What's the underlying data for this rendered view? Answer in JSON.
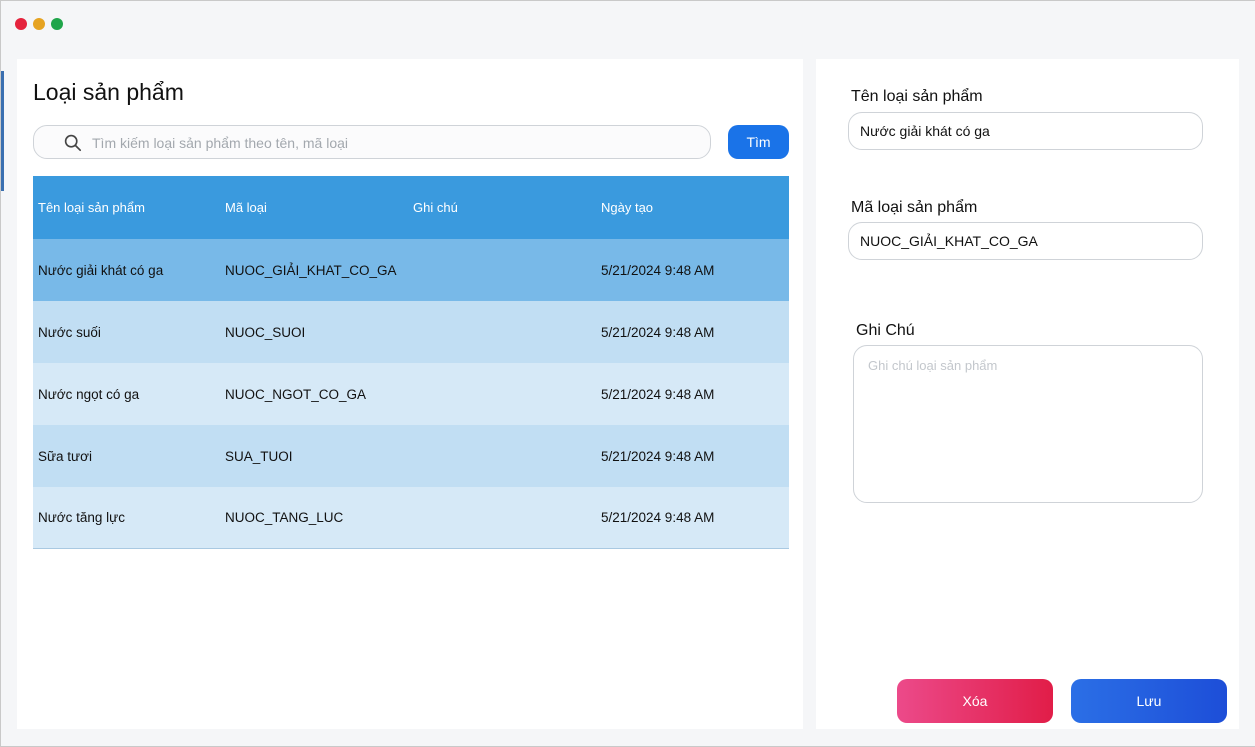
{
  "window": {
    "controls": [
      "close",
      "minimize",
      "maximize"
    ]
  },
  "list_panel": {
    "title": "Loại sản phẩm",
    "search": {
      "placeholder": "Tìm kiếm loại sản phẩm theo tên, mã loại",
      "value": "",
      "icon": "search-icon",
      "button_label": "Tìm"
    },
    "table": {
      "headers": [
        "Tên loại sản phẩm",
        "Mã loại",
        "Ghi chú",
        "Ngày tạo"
      ],
      "rows": [
        [
          "Nước giải khát có ga",
          "NUOC_GIẢI_KHAT_CO_GA",
          "",
          "5/21/2024 9:48 AM"
        ],
        [
          "Nước suối",
          "NUOC_SUOI",
          "",
          "5/21/2024 9:48 AM"
        ],
        [
          "Nước ngọt có ga",
          "NUOC_NGOT_CO_GA",
          "",
          "5/21/2024 9:48 AM"
        ],
        [
          "Sữa tươi",
          "SUA_TUOI",
          "",
          "5/21/2024 9:48 AM"
        ],
        [
          "Nước tăng lực",
          "NUOC_TANG_LUC",
          "",
          "5/21/2024 9:48 AM"
        ]
      ],
      "selected_row": 0
    }
  },
  "form_panel": {
    "name_label": "Tên loại sản phẩm",
    "name_value": "Nước giải khát có ga",
    "code_label": "Mã loại sản phẩm",
    "code_value": "NUOC_GIẢI_KHAT_CO_GA",
    "note_label": "Ghi Chú",
    "note_placeholder": "Ghi chú loại sản phẩm",
    "note_value": "",
    "delete_label": "Xóa",
    "save_label": "Lưu"
  },
  "colors": {
    "header_bg": "#3a9ade",
    "selected_row_bg": "#78b9e8",
    "row_alt_1": "#c1def3",
    "row_alt_2": "#d6e9f7",
    "primary_button": "#1a73e8",
    "delete_button": "#e11d48"
  }
}
